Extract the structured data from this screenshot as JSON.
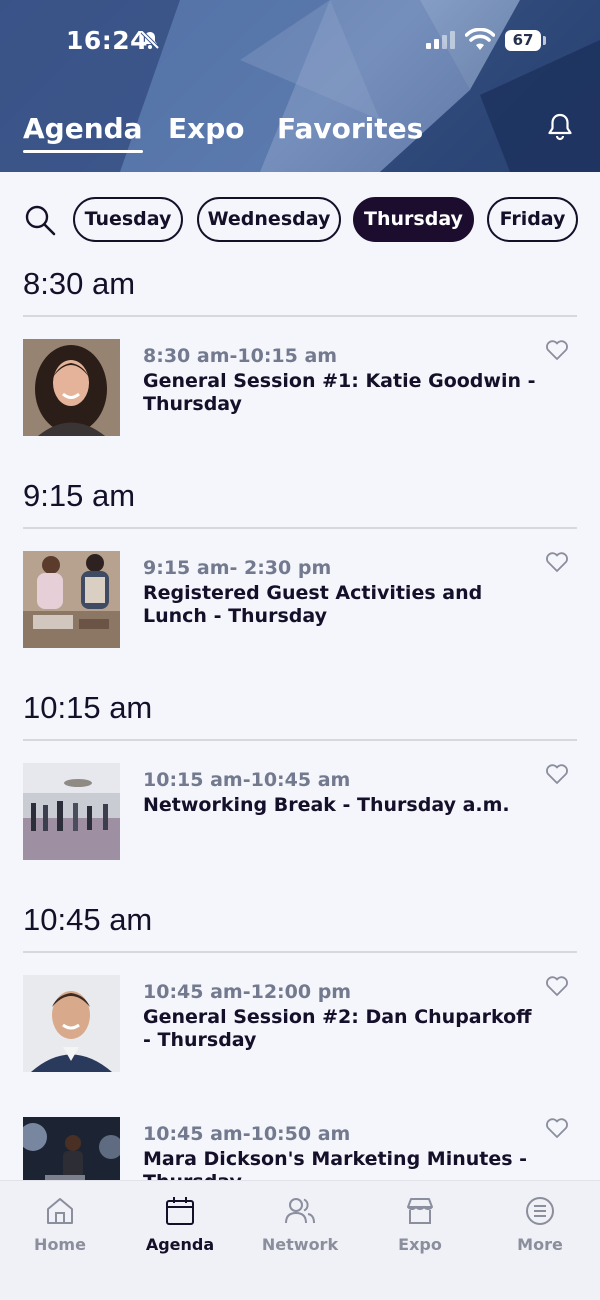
{
  "status_bar": {
    "time": "16:24",
    "battery": "67"
  },
  "top_tabs": [
    {
      "label": "Agenda",
      "active": true
    },
    {
      "label": "Expo",
      "active": false
    },
    {
      "label": "Favorites",
      "active": false
    }
  ],
  "days": [
    {
      "label": "Tuesday",
      "active": false
    },
    {
      "label": "Wednesday",
      "active": false
    },
    {
      "label": "Thursday",
      "active": true
    },
    {
      "label": "Friday",
      "active": false
    }
  ],
  "groups": [
    {
      "time_header": "8:30 am",
      "sessions": [
        {
          "time": "8:30 am-10:15 am",
          "title": "General Session #1: Katie Goodwin - Thursday",
          "favorited": false
        }
      ]
    },
    {
      "time_header": "9:15 am",
      "sessions": [
        {
          "time": "9:15 am- 2:30 pm",
          "title": "Registered Guest Activities and Lunch - Thursday",
          "favorited": false
        }
      ]
    },
    {
      "time_header": "10:15 am",
      "sessions": [
        {
          "time": "10:15 am-10:45 am",
          "title": "Networking Break - Thursday a.m.",
          "favorited": false
        }
      ]
    },
    {
      "time_header": "10:45 am",
      "sessions": [
        {
          "time": "10:45 am-12:00 pm",
          "title": "General Session #2: Dan Chuparkoff - Thursday",
          "favorited": false
        },
        {
          "time": "10:45 am-10:50 am",
          "title": "Mara Dickson's Marketing Minutes - Thursday",
          "favorited": false
        }
      ]
    }
  ],
  "bottom_nav": [
    {
      "label": "Home",
      "icon": "home-icon",
      "active": false
    },
    {
      "label": "Agenda",
      "icon": "calendar-icon",
      "active": true
    },
    {
      "label": "Network",
      "icon": "people-icon",
      "active": false
    },
    {
      "label": "Expo",
      "icon": "store-icon",
      "active": false
    },
    {
      "label": "More",
      "icon": "menu-circle-icon",
      "active": false
    }
  ],
  "colors": {
    "accent_dark": "#1c0d2e",
    "text_muted": "#737a8f",
    "nav_inactive": "#8a8e9d"
  }
}
